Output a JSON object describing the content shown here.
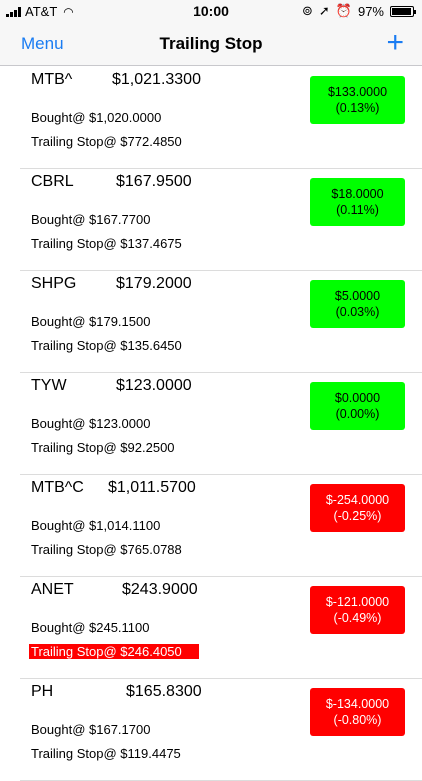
{
  "status": {
    "carrier": "AT&T",
    "time": "10:00",
    "battery": "97%",
    "battery_level": 0.97
  },
  "nav": {
    "left_label": "Menu",
    "title": "Trailing Stop",
    "add_icon": "+"
  },
  "colors": {
    "accent": "#1a7cf2",
    "gain": "#00ff00",
    "loss": "#ff0000"
  },
  "rows": [
    {
      "ticker": "MTB^",
      "price": "$1,021.3300",
      "bought": "Bought@ $1,020.0000",
      "stop": "Trailing Stop@ $772.4850",
      "change": "$133.0000",
      "pct": "(0.13%)",
      "direction": "gain",
      "alert": false
    },
    {
      "ticker": "CBRL",
      "price": "$167.9500",
      "bought": "Bought@ $167.7700",
      "stop": "Trailing Stop@ $137.4675",
      "change": "$18.0000",
      "pct": "(0.11%)",
      "direction": "gain",
      "alert": false
    },
    {
      "ticker": "SHPG",
      "price": "$179.2000",
      "bought": "Bought@ $179.1500",
      "stop": "Trailing Stop@ $135.6450",
      "change": "$5.0000",
      "pct": "(0.03%)",
      "direction": "gain",
      "alert": false
    },
    {
      "ticker": "TYW",
      "price": "$123.0000",
      "bought": "Bought@ $123.0000",
      "stop": "Trailing Stop@ $92.2500",
      "change": "$0.0000",
      "pct": "(0.00%)",
      "direction": "gain",
      "alert": false
    },
    {
      "ticker": "MTB^C",
      "price": "$1,011.5700",
      "bought": "Bought@ $1,014.1100",
      "stop": "Trailing Stop@ $765.0788",
      "change": "$-254.0000",
      "pct": "(-0.25%)",
      "direction": "loss",
      "alert": false
    },
    {
      "ticker": "ANET",
      "price": "$243.9000",
      "bought": "Bought@ $245.1100",
      "stop": "Trailing Stop@ $246.4050",
      "change": "$-121.0000",
      "pct": "(-0.49%)",
      "direction": "loss",
      "alert": true
    },
    {
      "ticker": "PH",
      "price": "$165.8300",
      "bought": "Bought@ $167.1700",
      "stop": "Trailing Stop@ $119.4475",
      "change": "$-134.0000",
      "pct": "(-0.80%)",
      "direction": "loss",
      "alert": false
    }
  ]
}
